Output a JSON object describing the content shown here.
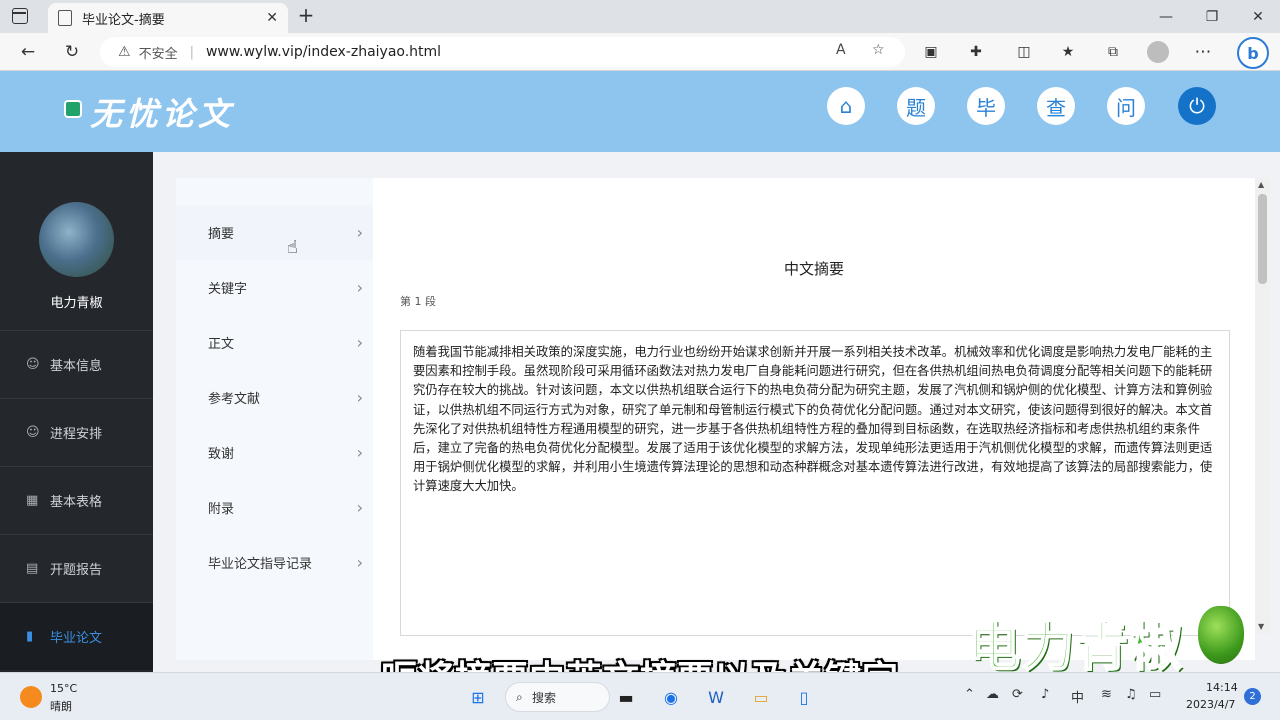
{
  "browser": {
    "tab_title": "毕业论文-摘要",
    "tab_close": "✕",
    "new_tab": "+",
    "minimize": "—",
    "restore": "❐",
    "close": "✕",
    "security_label": "不安全",
    "url": "www.wylw.vip/index-zhaiyao.html"
  },
  "site": {
    "logo_text": "无忧论文",
    "header_icons": [
      "题",
      "毕",
      "查",
      "问"
    ]
  },
  "user": {
    "name": "电力青椒"
  },
  "left_nav": [
    {
      "label": "基本信息",
      "icon": "user-icon"
    },
    {
      "label": "进程安排",
      "icon": "user-clock-icon"
    },
    {
      "label": "基本表格",
      "icon": "table-icon"
    },
    {
      "label": "开题报告",
      "icon": "calendar-icon"
    },
    {
      "label": "毕业论文",
      "icon": "book-icon",
      "active": true
    }
  ],
  "sub_nav": [
    {
      "label": "摘要",
      "active": true
    },
    {
      "label": "关键字"
    },
    {
      "label": "正文"
    },
    {
      "label": "参考文献"
    },
    {
      "label": "致谢"
    },
    {
      "label": "附录"
    },
    {
      "label": "毕业论文指导记录"
    }
  ],
  "document": {
    "title": "中文摘要",
    "segment": "第 1 段",
    "body": "随着我国节能减排相关政策的深度实施，电力行业也纷纷开始谋求创新并开展一系列相关技术改革。机械效率和优化调度是影响热力发电厂能耗的主要因素和控制手段。虽然现阶段可采用循环函数法对热力发电厂自身能耗问题进行研究，但在各供热机组间热电负荷调度分配等相关问题下的能耗研究仍存在较大的挑战。针对该问题，本文以供热机组联合运行下的热电负荷分配为研究主题，发展了汽机侧和锅炉侧的优化模型、计算方法和算例验证，以供热机组不同运行方式为对象，研究了单元制和母管制运行模式下的负荷优化分配问题。通过对本文研究，使该问题得到很好的解决。本文首先深化了对供热机组特性方程通用模型的研究，进一步基于各供热机组特性方程的叠加得到目标函数，在选取热经济指标和考虑供热机组约束条件后，建立了完备的热电负荷优化分配模型。发展了适用于该优化模型的求解方法，发现单纯形法更适用于汽机侧优化模型的求解，而遗传算法则更适用于锅炉侧优化模型的求解，并利用小生境遗传算法理论的思想和动态种群概念对基本遗传算法进行改进，有效地提高了该算法的局部搜索能力，使计算速度大大加快。"
  },
  "overlay": {
    "watermark": "电力青椒",
    "subtitle": "呃将摘要中英文摘要以及关键字"
  },
  "taskbar": {
    "temperature": "15°C",
    "weather": "晴朗",
    "search_label": "搜索",
    "ime": "中",
    "time": "14:14",
    "date": "2023/4/7",
    "notification_count": "2"
  },
  "colors": {
    "header_bg": "#8ec5ef",
    "sidebar_bg": "#24282d",
    "accent": "#1473c9",
    "watermark": "#3fb52d"
  }
}
